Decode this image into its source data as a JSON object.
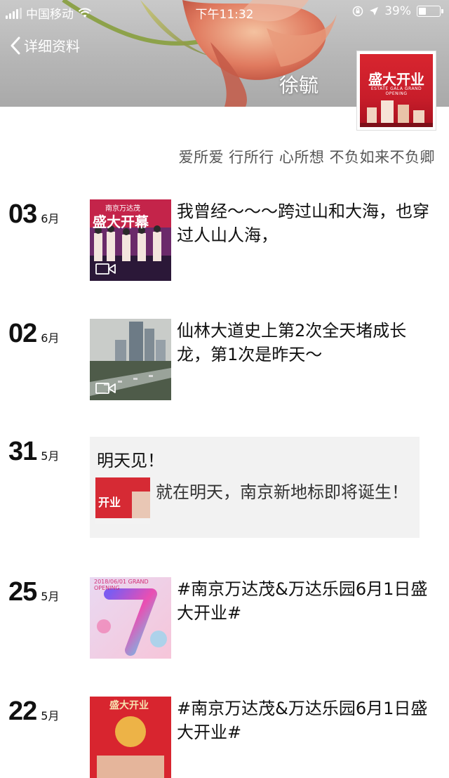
{
  "status_bar": {
    "carrier": "中国移动",
    "time": "下午11:32",
    "battery": "39%",
    "battery_level": 0.39
  },
  "nav": {
    "back_label": "详细资料"
  },
  "profile": {
    "name": "徐毓",
    "signature": "爱所爱 行所行 心所想 不负如来不负卿",
    "avatar_title": "盛大开业",
    "avatar_subtitle": "ESTATE GALA GRAND OPENING"
  },
  "posts": [
    {
      "day": "03",
      "month": "6月",
      "text": "我曾经～～～跨过山和大海，也穿过人山人海，",
      "thumb_label": "盛大开幕",
      "thumb_small": "南京万达茂",
      "media": "video"
    },
    {
      "day": "02",
      "month": "6月",
      "text": "仙林大道史上第2次全天堵成长龙，第1次是昨天～",
      "media": "video"
    },
    {
      "day": "31",
      "month": "5月",
      "share_title": "明天见！",
      "share_text": "就在明天，南京新地标即将诞生！",
      "thumb_label": "开业"
    },
    {
      "day": "25",
      "month": "5月",
      "text": "#南京万达茂&万达乐园6月1日盛大开业#",
      "thumb_label": "2018/06/01 GRAND OPENING"
    },
    {
      "day": "22",
      "month": "5月",
      "text": "#南京万达茂&万达乐园6月1日盛大开业#",
      "thumb_label": "盛大开业"
    }
  ],
  "colors": {
    "brand_red": "#d8252f",
    "share_bg": "#f2f2f2",
    "signature_gray": "#555555"
  }
}
